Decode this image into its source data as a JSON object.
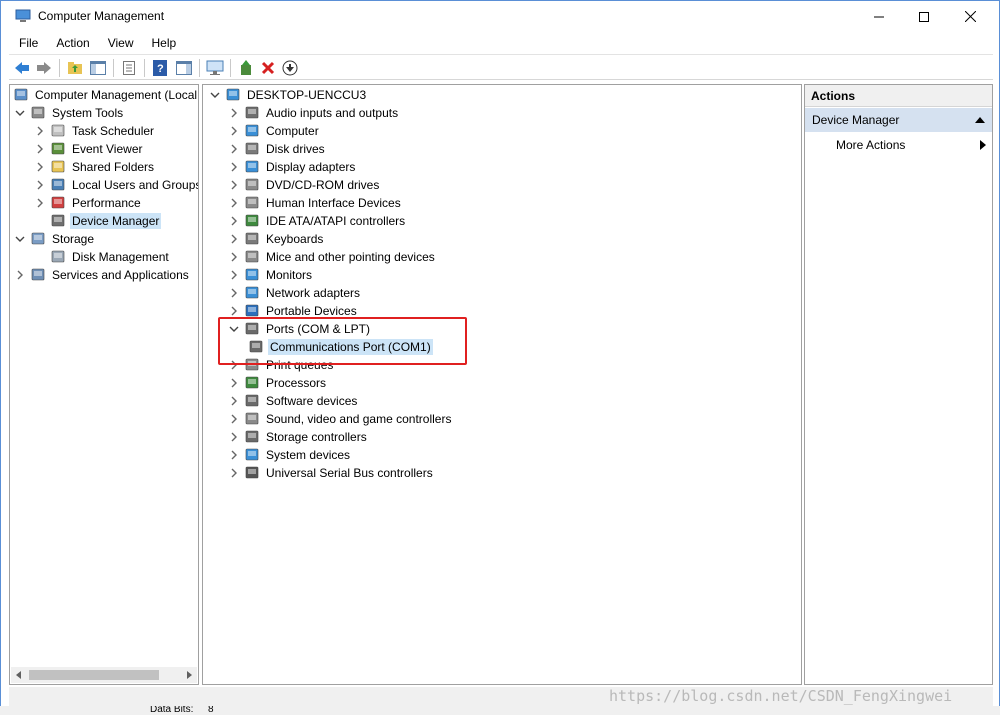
{
  "window": {
    "title": "Computer Management"
  },
  "menu": [
    "File",
    "Action",
    "View",
    "Help"
  ],
  "left_tree": [
    {
      "label": "Computer Management (Local",
      "indent": 0,
      "chev": "",
      "icon": "computer-management-icon"
    },
    {
      "label": "System Tools",
      "indent": 1,
      "chev": "down",
      "icon": "system-tools-icon"
    },
    {
      "label": "Task Scheduler",
      "indent": 2,
      "chev": "right",
      "icon": "task-scheduler-icon"
    },
    {
      "label": "Event Viewer",
      "indent": 2,
      "chev": "right",
      "icon": "event-viewer-icon"
    },
    {
      "label": "Shared Folders",
      "indent": 2,
      "chev": "right",
      "icon": "shared-folders-icon"
    },
    {
      "label": "Local Users and Groups",
      "indent": 2,
      "chev": "right",
      "icon": "local-users-icon"
    },
    {
      "label": "Performance",
      "indent": 2,
      "chev": "right",
      "icon": "performance-icon"
    },
    {
      "label": "Device Manager",
      "indent": 2,
      "chev": "",
      "icon": "device-manager-icon",
      "selected": true
    },
    {
      "label": "Storage",
      "indent": 1,
      "chev": "down",
      "icon": "storage-icon"
    },
    {
      "label": "Disk Management",
      "indent": 2,
      "chev": "",
      "icon": "disk-management-icon"
    },
    {
      "label": "Services and Applications",
      "indent": 1,
      "chev": "right",
      "icon": "services-icon"
    }
  ],
  "device_tree": {
    "root": "DESKTOP-UENCCU3",
    "items": [
      {
        "label": "Audio inputs and outputs",
        "icon": "audio-icon"
      },
      {
        "label": "Computer",
        "icon": "computer-icon"
      },
      {
        "label": "Disk drives",
        "icon": "disk-drive-icon"
      },
      {
        "label": "Display adapters",
        "icon": "display-adapter-icon"
      },
      {
        "label": "DVD/CD-ROM drives",
        "icon": "dvd-drive-icon"
      },
      {
        "label": "Human Interface Devices",
        "icon": "hid-icon"
      },
      {
        "label": "IDE ATA/ATAPI controllers",
        "icon": "ide-controller-icon"
      },
      {
        "label": "Keyboards",
        "icon": "keyboard-icon"
      },
      {
        "label": "Mice and other pointing devices",
        "icon": "mouse-icon"
      },
      {
        "label": "Monitors",
        "icon": "monitor-icon"
      },
      {
        "label": "Network adapters",
        "icon": "network-adapter-icon"
      },
      {
        "label": "Portable Devices",
        "icon": "portable-device-icon"
      },
      {
        "label": "Ports (COM & LPT)",
        "icon": "port-icon",
        "expanded": true
      },
      {
        "label": "Communications Port (COM1)",
        "icon": "com-port-icon",
        "child": true,
        "selected": true
      },
      {
        "label": "Print queues",
        "icon": "printer-icon"
      },
      {
        "label": "Processors",
        "icon": "processor-icon"
      },
      {
        "label": "Software devices",
        "icon": "software-device-icon"
      },
      {
        "label": "Sound, video and game controllers",
        "icon": "sound-icon"
      },
      {
        "label": "Storage controllers",
        "icon": "storage-controller-icon"
      },
      {
        "label": "System devices",
        "icon": "system-device-icon"
      },
      {
        "label": "Universal Serial Bus controllers",
        "icon": "usb-icon"
      }
    ]
  },
  "actions": {
    "header": "Actions",
    "section": "Device Manager",
    "more": "More Actions"
  },
  "watermark": "https://blog.csdn.net/CSDN_FengXingwei",
  "bottom_strip": {
    "label": "Data Bits:",
    "value": "8"
  },
  "colors": {
    "selection": "#cce4f7",
    "highlight_box": "#e02020",
    "actions_section": "#d5e1f0"
  }
}
